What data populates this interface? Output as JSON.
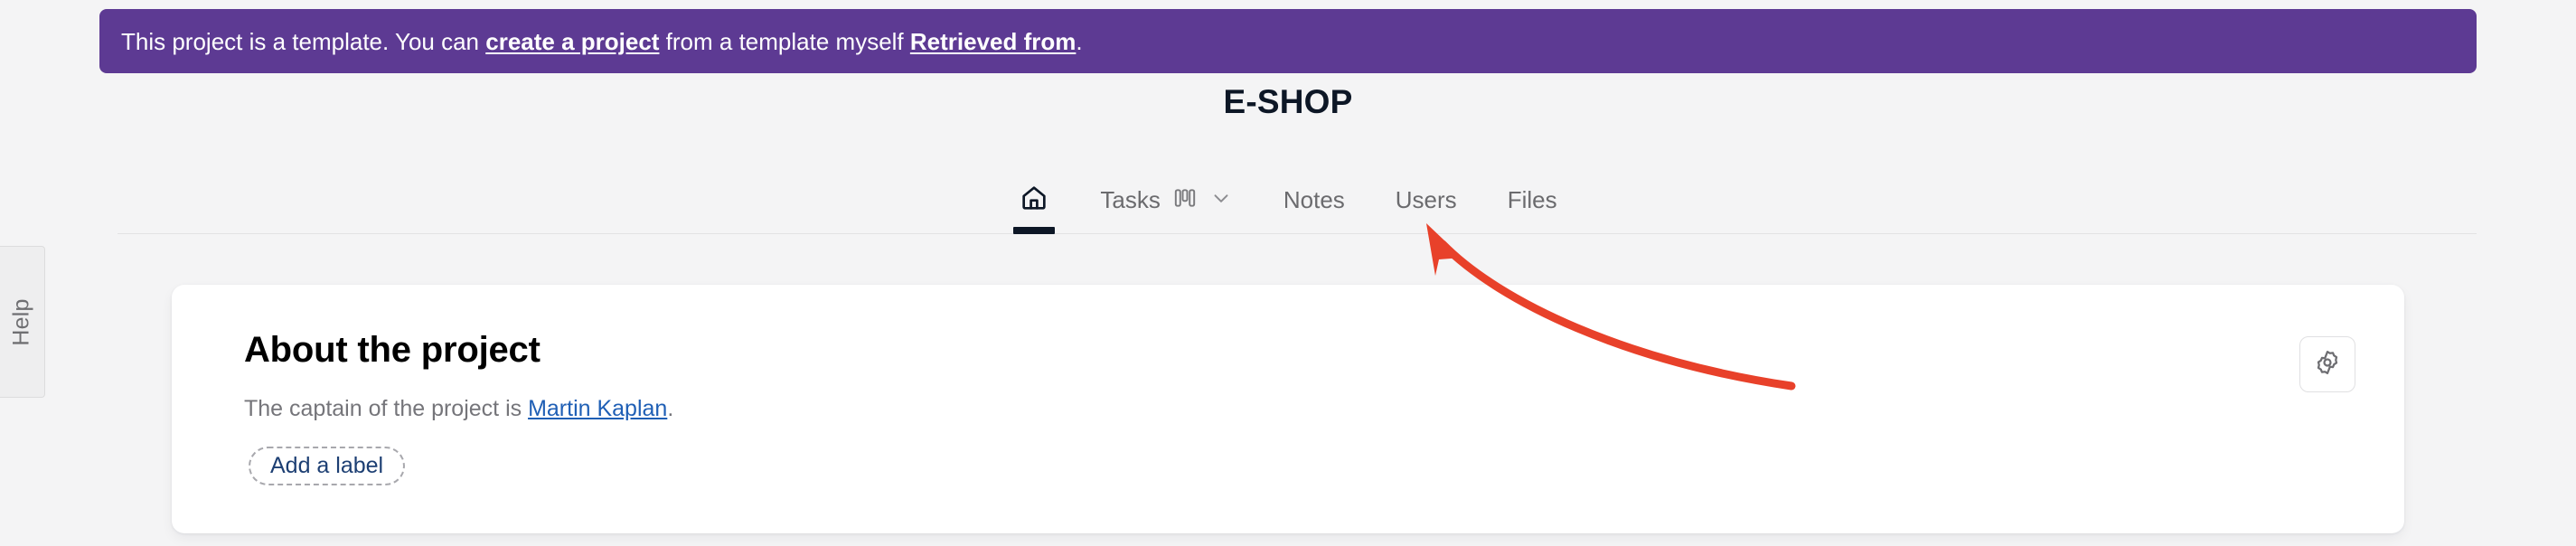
{
  "help_tab": {
    "label": "Help",
    "icon": "help-tab"
  },
  "banner": {
    "text_before": "This project is a template. You can ",
    "link_create": "create a project",
    "text_middle": " from a template myself ",
    "link_retrieved": "Retrieved from",
    "text_after": ".",
    "background_color": "#5d3a93"
  },
  "header": {
    "project_title": "E-SHOP",
    "title_color": "#0d1726"
  },
  "nav": {
    "items": [
      {
        "label": "",
        "icon": "home-icon",
        "active": true
      },
      {
        "label": "Tasks",
        "icon": "board-icon",
        "has_chevron": true,
        "active": false
      },
      {
        "label": "Notes",
        "icon": "",
        "active": false
      },
      {
        "label": "Users",
        "icon": "",
        "active": false
      },
      {
        "label": "Files",
        "icon": "",
        "active": false
      }
    ],
    "inactive_color": "#6b6b6e",
    "active_color": "#0d1726"
  },
  "card": {
    "heading": "About the project",
    "captain_prefix": "The captain of the project is ",
    "captain_name": "Martin Kaplan",
    "captain_suffix": ".",
    "captain_link_color": "#1f5fb5",
    "add_label_button": "Add a label",
    "settings_button_icon": "gear-icon"
  },
  "annotation": {
    "arrow_color": "#e8412a",
    "points_to": "Users"
  }
}
